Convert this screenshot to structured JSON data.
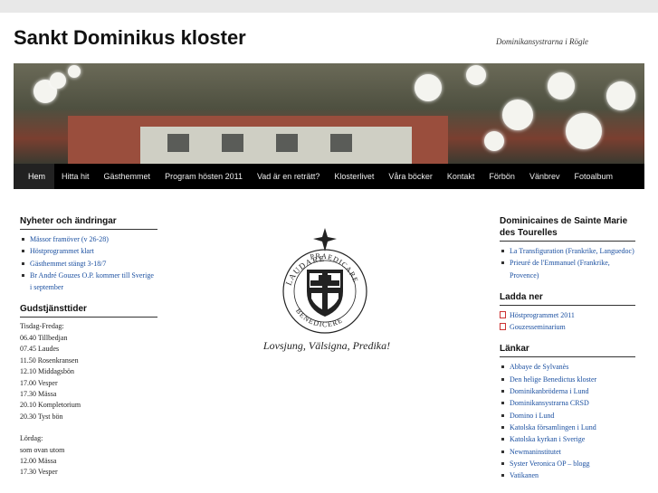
{
  "site": {
    "title": "Sankt Dominikus kloster",
    "tagline": "Dominikansystrarna i Rögle"
  },
  "nav": [
    {
      "label": "Hem",
      "active": true
    },
    {
      "label": "Hitta hit"
    },
    {
      "label": "Gästhemmet"
    },
    {
      "label": "Program hösten 2011"
    },
    {
      "label": "Vad är en reträtt?"
    },
    {
      "label": "Klosterlivet"
    },
    {
      "label": "Våra böcker"
    },
    {
      "label": "Kontakt"
    },
    {
      "label": "Förbön"
    },
    {
      "label": "Vänbrev"
    },
    {
      "label": "Fotoalbum"
    }
  ],
  "news": {
    "title": "Nyheter och ändringar",
    "items": [
      "Mässor framöver (v 26-28)",
      "Höstprogrammet klart",
      "Gästhemmet stängt 3-18/7",
      "Br André Gouzes O.P. kommer till Sverige i september"
    ]
  },
  "services": {
    "title": "Gudstjänsttider",
    "weekday_heading": "Tisdag-Fredag:",
    "weekday": [
      "06.40 Tillbedjan",
      "07.45 Laudes",
      "11.50 Rosenkransen",
      "12.10 Middagsbön",
      "17.00 Vesper",
      "17.30 Mässa",
      "20.10 Kompletorium",
      "20.30 Tyst bön"
    ],
    "saturday_heading": "Lördag:",
    "saturday": [
      "som ovan utom",
      "12.00 Mässa",
      "17.30 Vesper"
    ]
  },
  "center": {
    "motto": "Lovsjung, Välsigna, Predika!",
    "logo_text_top": "LAUDARE",
    "logo_text_right": "PRAEDICARE",
    "logo_text_bottom": "BENEDICERE"
  },
  "dominicaines": {
    "title": "Dominicaines de Sainte Marie des Tourelles",
    "items": [
      "La Transfiguration (Frankrike, Languedoc)",
      "Prieuré de l'Emmanuel (Frankrike, Provence)"
    ]
  },
  "downloads": {
    "title": "Ladda ner",
    "items": [
      "Höstprogrammet 2011",
      "Gouzesseminarium"
    ]
  },
  "links": {
    "title": "Länkar",
    "items": [
      "Abbaye de Sylvanès",
      "Den helige Benedictus kloster",
      "Dominikanbröderna i Lund",
      "Dominikansystrarna CRSD",
      "Domino i Lund",
      "Katolska församlingen i Lund",
      "Katolska kyrkan i Sverige",
      "Newmaninstitutet",
      "Syster Veronica OP – blogg",
      "Vatikanen"
    ]
  }
}
